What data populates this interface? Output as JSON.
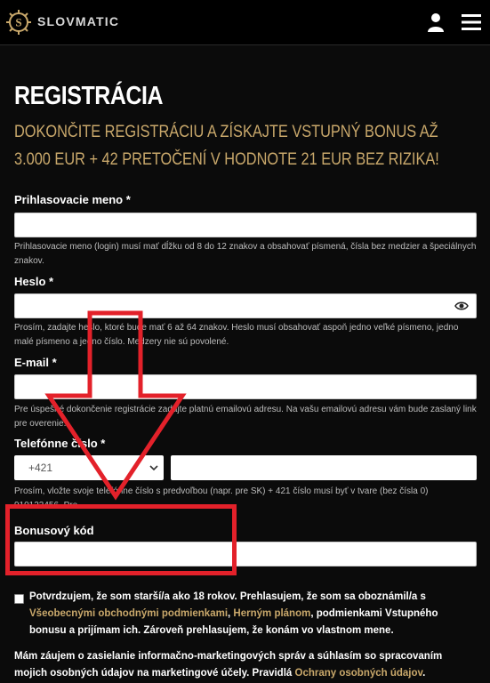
{
  "header": {
    "brand": "SLOVMATIC",
    "logo_icon": "slot-wheel-logo-icon",
    "user_icon": "user-icon",
    "menu_icon": "hamburger-menu-icon"
  },
  "page": {
    "title": "REGISTRÁCIA",
    "subtitle": "DOKONČITE REGISTRÁCIU A ZÍSKAJTE VSTUPNÝ BONUS AŽ 3.000 EUR + 42 PRETOČENÍ V HODNOTE 21 EUR BEZ RIZIKA!"
  },
  "form": {
    "username": {
      "label": "Prihlasovacie meno *",
      "value": "",
      "help": "Prihlasovacie meno (login) musí mať dĺžku od 8 do 12 znakov a obsahovať písmená, čísla bez medzier a špeciálnych znakov."
    },
    "password": {
      "label": "Heslo *",
      "value": "",
      "help": "Prosím, zadajte heslo, ktoré bude mať 6 až 64 znakov. Heslo musí obsahovať aspoň jedno veľké písmeno, jedno malé písmeno a jedno číslo. Medzery nie sú povolené."
    },
    "email": {
      "label": "E-mail *",
      "value": "",
      "help": "Pre úspešné dokončenie registrácie zadajte platnú emailovú adresu. Na vašu emailovú adresu vám bude zaslaný link pre overenie."
    },
    "phone": {
      "label": "Telefónne číslo *",
      "prefix": "+421",
      "value": "",
      "help": "Prosím, vložte svoje telefónne číslo s predvoľbou (napr. pre SK) + 421 číslo musí byť v tvare (bez čísla 0) 910123456. Pre"
    },
    "bonus": {
      "label": "Bonusový kód",
      "value": ""
    },
    "consent": {
      "text_1": "Potvrdzujem, že som starší/a ako 18 rokov. Prehlasujem, že som sa oboznámil/a s ",
      "link_1": "Všeobecnými obchodnými podmienkami",
      "text_2": ", ",
      "link_2": "Herným plánom",
      "text_3": ", podmienkami Vstupného bonusu a prijímam ich. Zároveň prehlasujem, že konám vo vlastnom mene."
    },
    "marketing": {
      "text_1": "Mám záujem o zasielanie informačno-marketingových správ a súhlasím so spracovaním mojich osobných údajov na marketingové účely. Pravidlá ",
      "link_1": "Ochrany osobných údajov",
      "text_2": "."
    }
  },
  "colors": {
    "accent": "#c9a86b",
    "annotation": "#e3212a"
  }
}
